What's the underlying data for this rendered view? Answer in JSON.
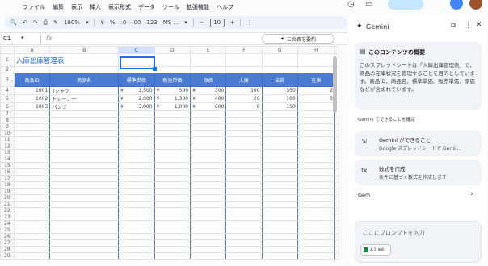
{
  "menu": [
    "ファイル",
    "編集",
    "表示",
    "挿入",
    "表示形式",
    "データ",
    "ツール",
    "拡張機能",
    "ヘルプ"
  ],
  "toolbar": {
    "zoom": "100%",
    "percent": "%",
    "decimal_dec": ".0",
    "decimal_inc": ".00",
    "number_format": "123",
    "font": "MS ...",
    "font_size": "10"
  },
  "formula": {
    "cell": "C1",
    "fx": "fx"
  },
  "share_button": "この表を要約",
  "columns": [
    "A",
    "B",
    "C",
    "D",
    "E",
    "F",
    "G",
    "H"
  ],
  "rows": [
    "1",
    "2",
    "3",
    "4",
    "5",
    "6",
    "7",
    "8",
    "9",
    "10",
    "11",
    "12",
    "13",
    "14",
    "15",
    "16",
    "17",
    "18",
    "19",
    "20",
    "21",
    "22",
    "23",
    "24",
    "25",
    "26",
    "27",
    "28",
    "29"
  ],
  "sheet": {
    "title": "入庫出庫管理表",
    "headers": [
      "商品ID",
      "商品名",
      "標準単価",
      "販売単価",
      "原価",
      "入庫",
      "出荷",
      "在庫"
    ],
    "data": [
      [
        "1001",
        "Tシャツ",
        "¥",
        "1,500",
        "¥",
        "500",
        "¥",
        "300",
        "100",
        "350",
        "2"
      ],
      [
        "1002",
        "トレーナー",
        "¥",
        "2,000",
        "¥",
        "1,300",
        "¥",
        "400",
        "20",
        "100",
        "3"
      ],
      [
        "1003",
        "パンツ",
        "¥",
        "3,000",
        "¥",
        "1,000",
        "¥",
        "600",
        "0",
        "150",
        ""
      ]
    ]
  },
  "gemini": {
    "title": "Gemini",
    "overview_title": "このコンテンツの概要",
    "overview_text": "このスプレッドシートは「入庫出庫管理表」で、商品の在庫状況を管理することを目的としています。商品ID、商品名、標準単価、販売単価、原価などが含まれています。",
    "section": "Gemini でできることを確認",
    "card1_title": "Gemini ができること",
    "card1_sub": "Google スプレッドシートで Gemi...",
    "card2_title": "数式を作成",
    "card2_sub": "条件に基づく数式を作成します",
    "gem": "Gem",
    "prompt": "ここにプロンプトを入力",
    "chip": "A1:K6"
  }
}
